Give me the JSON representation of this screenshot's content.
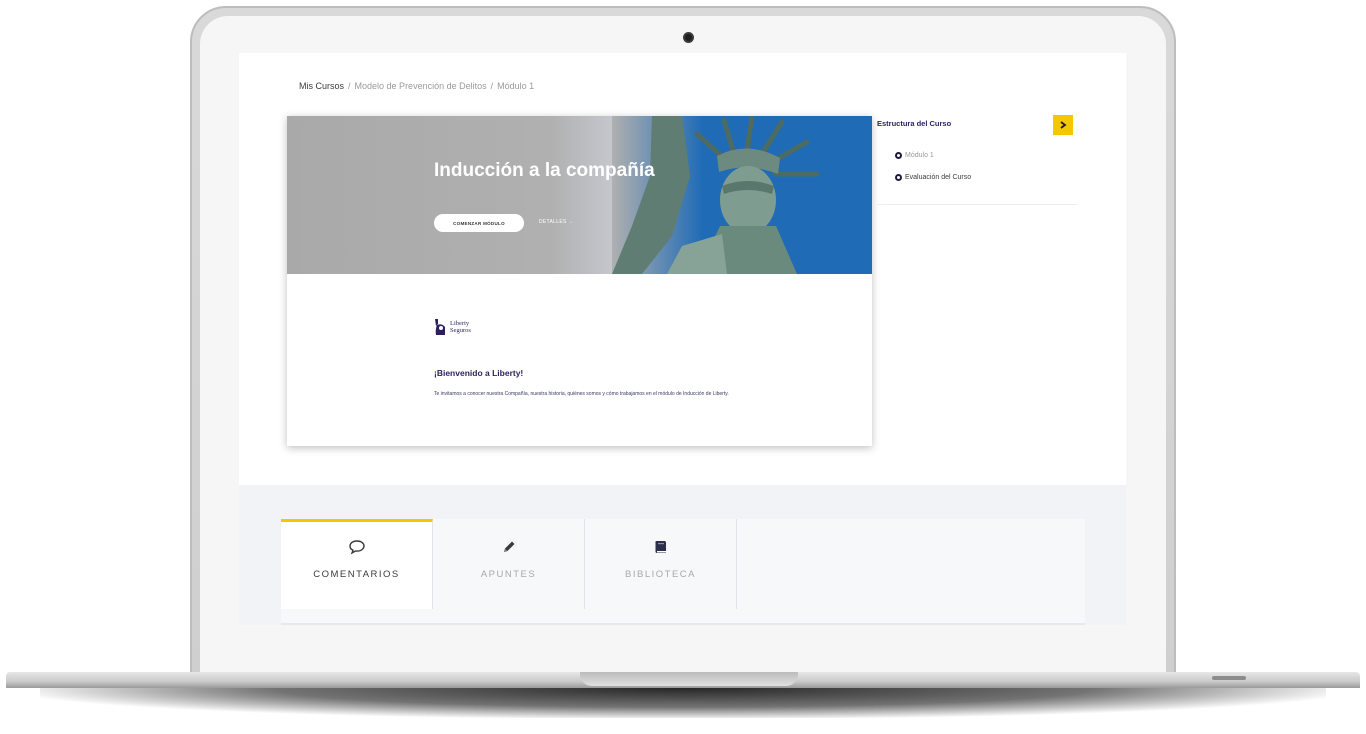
{
  "breadcrumb": {
    "home": "Mis Cursos",
    "separator": "/",
    "course": "Modelo de Prevención de Delitos",
    "current": "Módulo 1"
  },
  "hero": {
    "title": "Inducción a la compañía",
    "start_button": "COMENZAR MÓDULO",
    "details_link": "DETALLES →"
  },
  "module": {
    "logo_line1": "Liberty",
    "logo_line2": "Seguros",
    "welcome_title": "¡Bienvenido a Liberty!",
    "welcome_text": "Te invitamos a conocer nuestra Compañía, nuestra historia, quiénes somos y cómo trabajamos en el módulo de Inducción de Liberty."
  },
  "structure": {
    "title": "Estructura del Curso",
    "toggle_icon": "chevron-right-icon",
    "items": [
      {
        "label": "Módulo 1"
      },
      {
        "label": "Evaluación del Curso"
      }
    ]
  },
  "tabs": [
    {
      "label": "COMENTARIOS",
      "icon": "comment-icon",
      "active": true
    },
    {
      "label": "APUNTES",
      "icon": "pencil-icon",
      "active": false
    },
    {
      "label": "BIBLIOTECA",
      "icon": "book-icon",
      "active": false
    }
  ],
  "colors": {
    "accent": "#f6c700",
    "brand": "#2b1f5e"
  }
}
